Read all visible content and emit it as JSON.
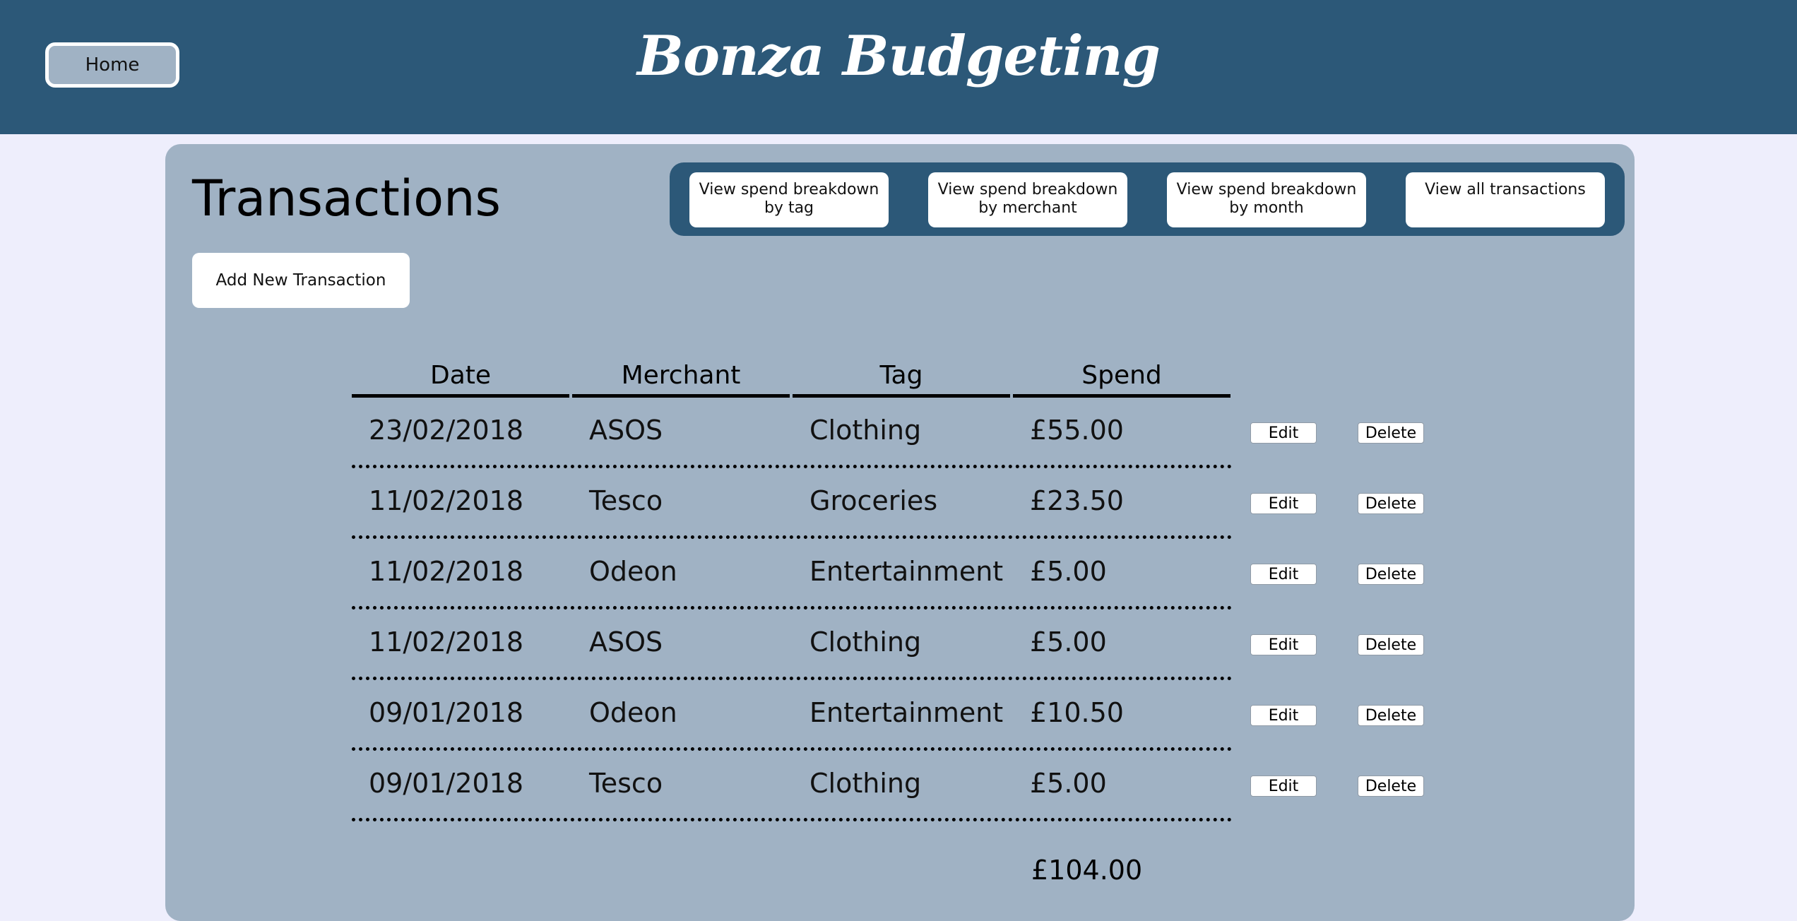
{
  "header": {
    "home_label": "Home",
    "site_title": "Bonza Budgeting"
  },
  "page": {
    "title": "Transactions",
    "add_button": "Add New Transaction"
  },
  "view_nav": [
    {
      "label": "View spend breakdown by tag"
    },
    {
      "label": "View spend breakdown by merchant"
    },
    {
      "label": "View spend breakdown by month"
    },
    {
      "label": "View all transactions"
    }
  ],
  "table": {
    "columns": [
      "Date",
      "Merchant",
      "Tag",
      "Spend"
    ],
    "rows": [
      {
        "date": "23/02/2018",
        "merchant": "ASOS",
        "tag": "Clothing",
        "spend": "£55.00"
      },
      {
        "date": "11/02/2018",
        "merchant": "Tesco",
        "tag": "Groceries",
        "spend": "£23.50"
      },
      {
        "date": "11/02/2018",
        "merchant": "Odeon",
        "tag": "Entertainment",
        "spend": "£5.00"
      },
      {
        "date": "11/02/2018",
        "merchant": "ASOS",
        "tag": "Clothing",
        "spend": "£5.00"
      },
      {
        "date": "09/01/2018",
        "merchant": "Odeon",
        "tag": "Entertainment",
        "spend": "£10.50"
      },
      {
        "date": "09/01/2018",
        "merchant": "Tesco",
        "tag": "Clothing",
        "spend": "£5.00"
      }
    ],
    "edit_label": "Edit",
    "delete_label": "Delete",
    "total": "£104.00"
  },
  "colors": {
    "header_bg": "#2c5878",
    "page_bg": "#eeeefc",
    "panel_bg": "#a0b2c4"
  }
}
